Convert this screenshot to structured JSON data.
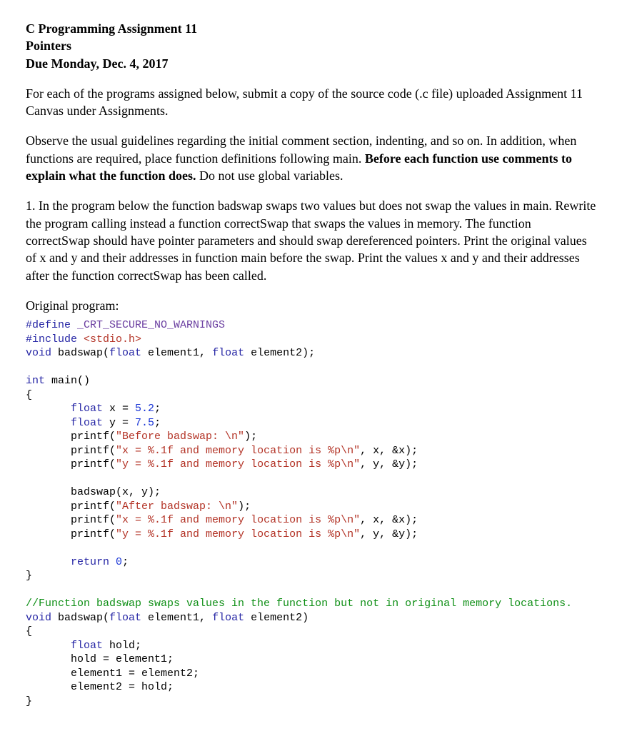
{
  "header": {
    "line1": "C Programming Assignment 11",
    "line2": "Pointers",
    "line3": "Due Monday, Dec. 4, 2017"
  },
  "para1": "For each of the programs assigned below, submit a copy of the source code (.c file) uploaded Assignment 11 Canvas under Assignments.",
  "para2": {
    "part1": "Observe the usual guidelines regarding the initial comment section, indenting, and so on.  In addition, when functions are required, place function definitions following main.  ",
    "bold": "Before each function use comments to explain what the function does.",
    "part2": "  Do not use global variables."
  },
  "para3": "1.  In the program below the function badswap swaps two values but does not swap the values in main.  Rewrite the program calling instead a function correctSwap that swaps the values in memory.  The function correctSwap should have pointer parameters and should swap dereferenced pointers.  Print the original values of x and y and their addresses in function main before the swap.  Print the values x and y and their addresses after the function correctSwap has been called.",
  "orig_label": "Original program:",
  "code": {
    "l01a": "#define",
    "l01b": " _CRT_SECURE_NO_WARNINGS",
    "l02a": "#include",
    "l02b": " <stdio.h>",
    "l03a": "void",
    "l03b": " badswap(",
    "l03c": "float",
    "l03d": " element1, ",
    "l03e": "float",
    "l03f": " element2);",
    "l05a": "int",
    "l05b": " main()",
    "l06": "{",
    "l07a": "       float",
    "l07b": " x = ",
    "l07c": "5.2",
    "l07d": ";",
    "l08a": "       float",
    "l08b": " y = ",
    "l08c": "7.5",
    "l08d": ";",
    "l09a": "       printf(",
    "l09b": "\"Before badswap: \\n\"",
    "l09c": ");",
    "l10a": "       printf(",
    "l10b": "\"x = %.1f and memory location is %p\\n\"",
    "l10c": ", x, &x);",
    "l11a": "       printf(",
    "l11b": "\"y = %.1f and memory location is %p\\n\"",
    "l11c": ", y, &y);",
    "l13a": "       badswap(x, y);",
    "l14a": "       printf(",
    "l14b": "\"After badswap: \\n\"",
    "l14c": ");",
    "l15a": "       printf(",
    "l15b": "\"x = %.1f and memory location is %p\\n\"",
    "l15c": ", x, &x);",
    "l16a": "       printf(",
    "l16b": "\"y = %.1f and memory location is %p\\n\"",
    "l16c": ", y, &y);",
    "l18a": "       return",
    "l18b": " ",
    "l18c": "0",
    "l18d": ";",
    "l19": "}",
    "l21": "//Function badswap swaps values in the function but not in original memory locations.",
    "l22a": "void",
    "l22b": " badswap(",
    "l22c": "float",
    "l22d": " element1, ",
    "l22e": "float",
    "l22f": " element2)",
    "l23": "{",
    "l24a": "       float",
    "l24b": " hold;",
    "l25": "       hold = element1;",
    "l26": "       element1 = element2;",
    "l27": "       element2 = hold;",
    "l28": "}"
  }
}
